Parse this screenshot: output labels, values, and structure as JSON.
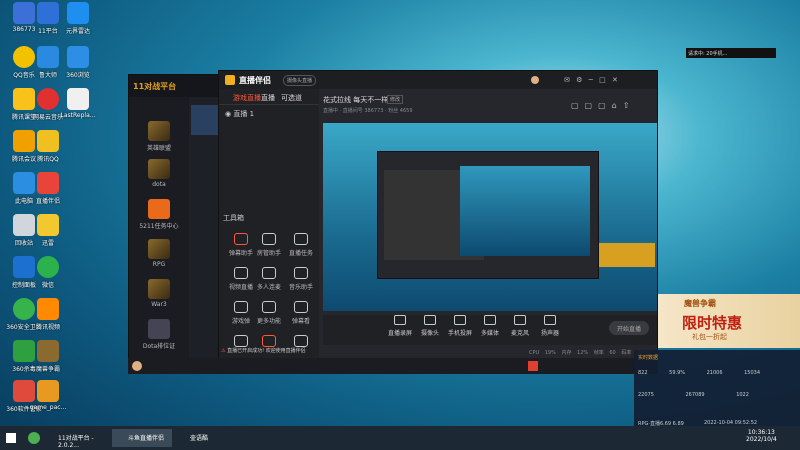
{
  "desktop": {
    "icons": [
      {
        "label": "386773",
        "color": "#3c6fd8"
      },
      {
        "label": "QQ音乐",
        "color": "#f2c200"
      },
      {
        "label": "腾讯课堂",
        "color": "#f8c21a"
      },
      {
        "label": "腾讯会议",
        "color": "#f0a000"
      },
      {
        "label": "此电脑",
        "color": "#2b8ee0"
      },
      {
        "label": "回收站",
        "color": "#d0d6dc"
      },
      {
        "label": "控制面板",
        "color": "#1b70d0"
      },
      {
        "label": "360安全卫士",
        "color": "#36b34a"
      },
      {
        "label": "360杀毒",
        "color": "#2fa040"
      },
      {
        "label": "360软件管家",
        "color": "#e04a3c"
      }
    ],
    "icons2": [
      {
        "label": "11平台",
        "color": "#2f6fd8"
      },
      {
        "label": "鲁大师",
        "color": "#2a8ae0"
      },
      {
        "label": "网易云音乐",
        "color": "#e03030"
      },
      {
        "label": "腾讯QQ",
        "color": "#f0c020"
      },
      {
        "label": "直播伴侣",
        "color": "#e8443a"
      },
      {
        "label": "迅雷",
        "color": "#f2c830"
      },
      {
        "label": "微信",
        "color": "#2bb24c"
      },
      {
        "label": "腾讯视频",
        "color": "#ff8a00"
      },
      {
        "label": "魔兽争霸",
        "color": "#8a6a2e"
      },
      {
        "label": "game_pac...",
        "color": "#e89a20"
      }
    ],
    "icons3": [
      {
        "label": "元界雷达",
        "color": "#1e8ef0"
      },
      {
        "label": "360浏览",
        "color": "#2d8ee5"
      },
      {
        "label": "LastRepla...",
        "color": "#f0f0f0"
      }
    ]
  },
  "platform11": {
    "logo": "11对战平台",
    "games": [
      "英雄联盟",
      "dota",
      "5211任务中心",
      "RPG",
      "War3",
      "Dota排位证"
    ]
  },
  "zhibo": {
    "title": "直播伴侣",
    "tab_cam": "摄像头直播",
    "left_tabs": [
      "游戏直播",
      "直播",
      "可选道"
    ],
    "scene": "直播 1",
    "toolbox": "工具箱",
    "tools": [
      "弹幕助手",
      "房管助手",
      "直播任务",
      "视频直播",
      "多人连麦",
      "音乐助手",
      "游戏弹",
      "更多功能",
      "弹幕看",
      "",
      "",
      ""
    ],
    "stream_title": "花式拉线 每天不一样",
    "stream_badge": "修改",
    "stream_meta": "直播中 · 直播间号 386773 · 粉丝 4659",
    "bottom_btns": [
      "直播录屏",
      "摄像头",
      "手机投屏",
      "多媒体",
      "麦克风",
      "扬声器",
      "本地录制"
    ],
    "go_live": "开始直播",
    "tip": "直播已开启成功! 欢迎使用直播伴侣",
    "status": [
      "CPU 19%",
      "内存 12%",
      "帧率 60",
      "码率 2500"
    ]
  },
  "ad": {
    "brand": "魔兽争霸",
    "headline": "限时特惠",
    "sub": "礼包一折起"
  },
  "stats": {
    "title": "实时数据",
    "row1": [
      "822",
      "59.9%",
      "21006",
      "15034"
    ],
    "row2": [
      "22075",
      "267089",
      "1022"
    ],
    "footer": "RPG·直播6.69 6.89",
    "date": "2022-10-04 09:52:52"
  },
  "notify": {
    "text": "请求中: 20手机..."
  },
  "taskbar": {
    "items": [
      "11对战平台 - 2.0.2...",
      "斗鱼直播伴侣",
      "壶语酷"
    ],
    "time": "10:36:13",
    "date": "2022/10/4"
  }
}
